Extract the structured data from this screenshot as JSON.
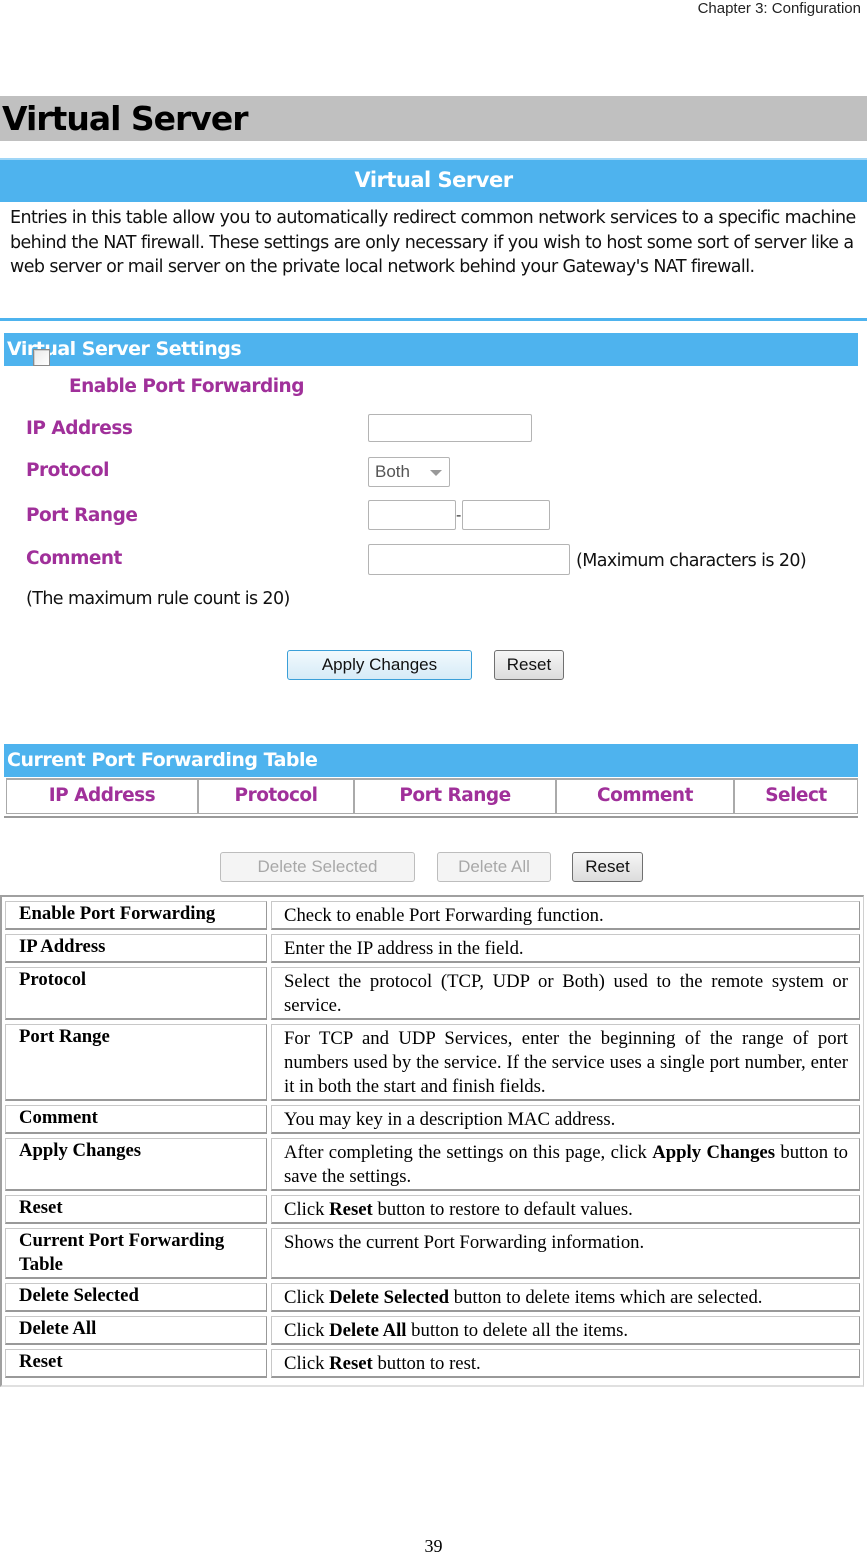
{
  "document": {
    "chapter_header": "Chapter 3: Configuration",
    "section_title": "Virtual Server",
    "page_number": "39"
  },
  "screenshot": {
    "banner_title": "Virtual Server",
    "intro_text": "Entries in this table allow you to automatically redirect common network services to a specific machine behind the NAT firewall. These settings are only necessary if you wish to host some sort of server like a web server or mail server on the private local network behind your Gateway's NAT firewall.",
    "settings": {
      "title": "Virtual Server Settings",
      "enable_port_forwarding": {
        "label": "Enable Port Forwarding",
        "checked": false
      },
      "ip_address": {
        "label": "IP Address",
        "value": ""
      },
      "protocol": {
        "label": "Protocol",
        "value": "Both"
      },
      "port_range": {
        "label": "Port Range",
        "start": "",
        "end": "",
        "separator": "-"
      },
      "comment": {
        "label": "Comment",
        "value": "",
        "hint": "(Maximum characters is 20)"
      },
      "max_rule_note": "(The maximum rule count is 20)",
      "apply_button": "Apply Changes",
      "reset_button": "Reset"
    },
    "forwarding_table": {
      "title": "Current Port Forwarding Table",
      "columns": [
        "IP Address",
        "Protocol",
        "Port Range",
        "Comment",
        "Select"
      ],
      "rows": [],
      "delete_selected_button": "Delete Selected",
      "delete_all_button": "Delete All",
      "reset_button": "Reset"
    }
  },
  "description_table": [
    {
      "term": "Enable Port Forwarding",
      "definition": [
        {
          "t": "Check to enable Port Forwarding function."
        }
      ]
    },
    {
      "term": "IP Address",
      "definition": [
        {
          "t": "Enter the IP address in the field."
        }
      ]
    },
    {
      "term": "Protocol",
      "definition": [
        {
          "t": "Select the protocol (TCP, UDP or Both) used to the remote system or service."
        }
      ]
    },
    {
      "term": "Port Range",
      "definition": [
        {
          "t": "For TCP and UDP Services, enter the beginning of the range of port numbers used by the service. If the service uses a single port number, enter it in both the start and finish fields."
        }
      ]
    },
    {
      "term": "Comment",
      "definition": [
        {
          "t": "You may key in a description MAC address."
        }
      ]
    },
    {
      "term": "Apply Changes",
      "definition": [
        {
          "t": "After completing the settings on this page, click "
        },
        {
          "b": "Apply Changes"
        },
        {
          "t": " button to save the settings."
        }
      ]
    },
    {
      "term": "Reset",
      "definition": [
        {
          "t": "Click "
        },
        {
          "b": "Reset"
        },
        {
          "t": " button to restore to default values."
        }
      ]
    },
    {
      "term": "Current Port Forwarding Table",
      "definition": [
        {
          "t": "Shows the current Port Forwarding information."
        }
      ]
    },
    {
      "term": "Delete Selected",
      "definition": [
        {
          "t": "Click "
        },
        {
          "b": "Delete Selected"
        },
        {
          "t": " button to delete items which are selected."
        }
      ]
    },
    {
      "term": "Delete All",
      "definition": [
        {
          "t": "Click "
        },
        {
          "b": "Delete All"
        },
        {
          "t": " button to delete all the items."
        }
      ]
    },
    {
      "term": "Reset",
      "definition": [
        {
          "t": "Click "
        },
        {
          "b": "Reset"
        },
        {
          "t": " button to rest."
        }
      ]
    }
  ],
  "colors": {
    "banner_blue": "#4eb3ee",
    "label_purple": "#a0309a",
    "title_bar_gray": "#c0c0c0"
  }
}
